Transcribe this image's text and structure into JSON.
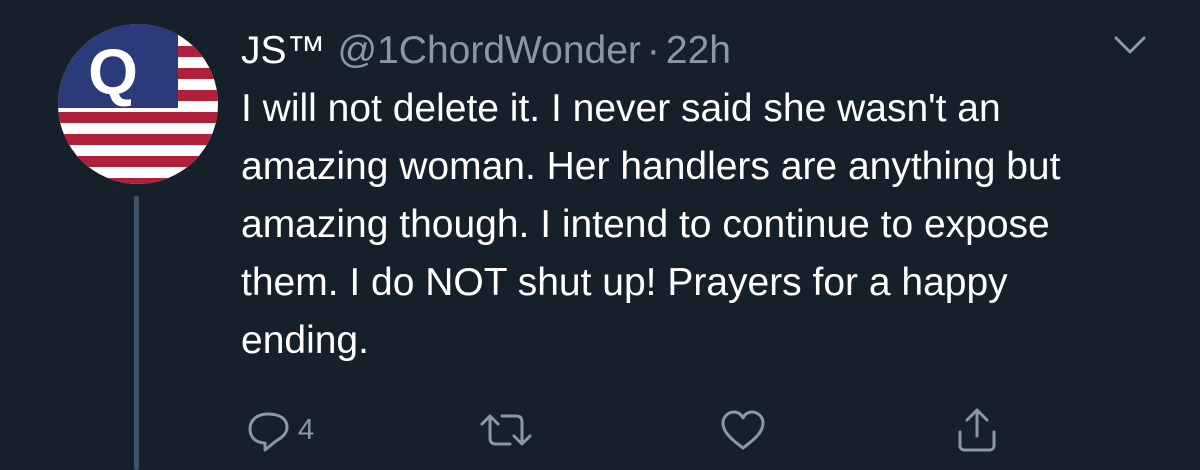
{
  "tweet": {
    "display_name": "JS™",
    "handle": "@1ChordWonder",
    "separator": "·",
    "time": "22h",
    "text": "I will not delete it. I never said she wasn't an amazing woman. Her handlers are anything but amazing though. I intend to continue to expose them. I do NOT shut up! Prayers for a happy ending.",
    "avatar_letter": "Q"
  },
  "actions": {
    "reply_count": "4",
    "icons": [
      "reply-icon",
      "retweet-icon",
      "like-icon",
      "share-icon"
    ]
  },
  "colors": {
    "background": "#15202b",
    "text_primary": "#ffffff",
    "text_secondary": "#8899a6",
    "thread_line": "#3d5466",
    "flag_blue": "#2b3a7a",
    "flag_red": "#b0203a"
  }
}
